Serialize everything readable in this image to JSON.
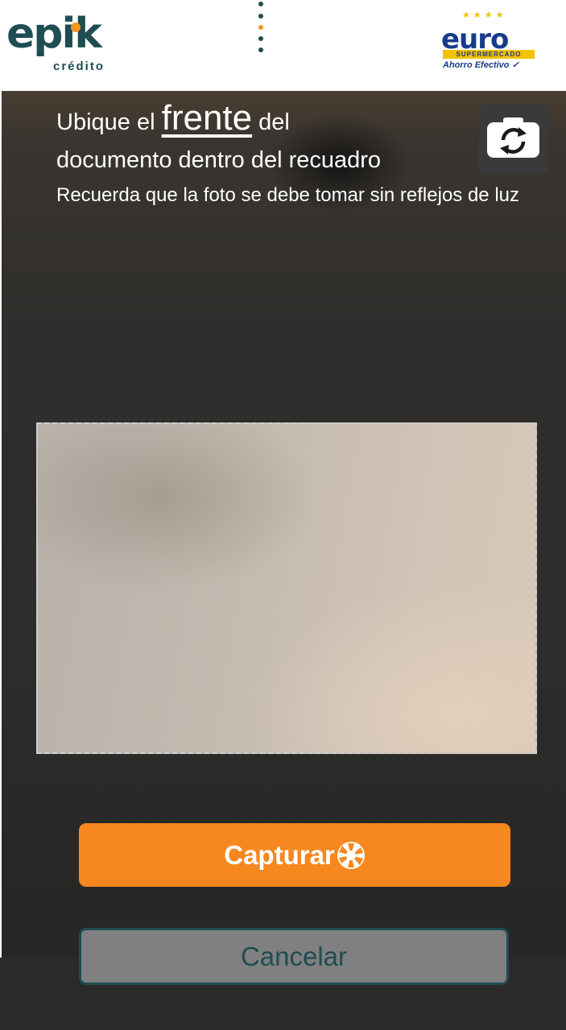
{
  "header": {
    "brand_left": {
      "name": "epik",
      "subtitle": "crédito"
    },
    "brand_right": {
      "name": "euro",
      "band": "SUPERMERCADO",
      "tagline": "Ahorro Efectivo"
    },
    "menu_icon": "vertical-dots-icon"
  },
  "instructions": {
    "prefix": "Ubique el",
    "highlight": "frente",
    "suffix": "del",
    "line2": "documento dentro del recuadro",
    "hint": "Recuerda que la foto se debe tomar sin reflejos de luz"
  },
  "camera": {
    "switch_icon": "camera-switch-icon"
  },
  "actions": {
    "capture_label": "Capturar",
    "capture_icon": "shutter-icon",
    "cancel_label": "Cancelar"
  },
  "colors": {
    "brand_orange": "#f7871f",
    "brand_teal": "#1e4d52",
    "euro_blue": "#173b8c",
    "euro_yellow": "#f2c200"
  }
}
